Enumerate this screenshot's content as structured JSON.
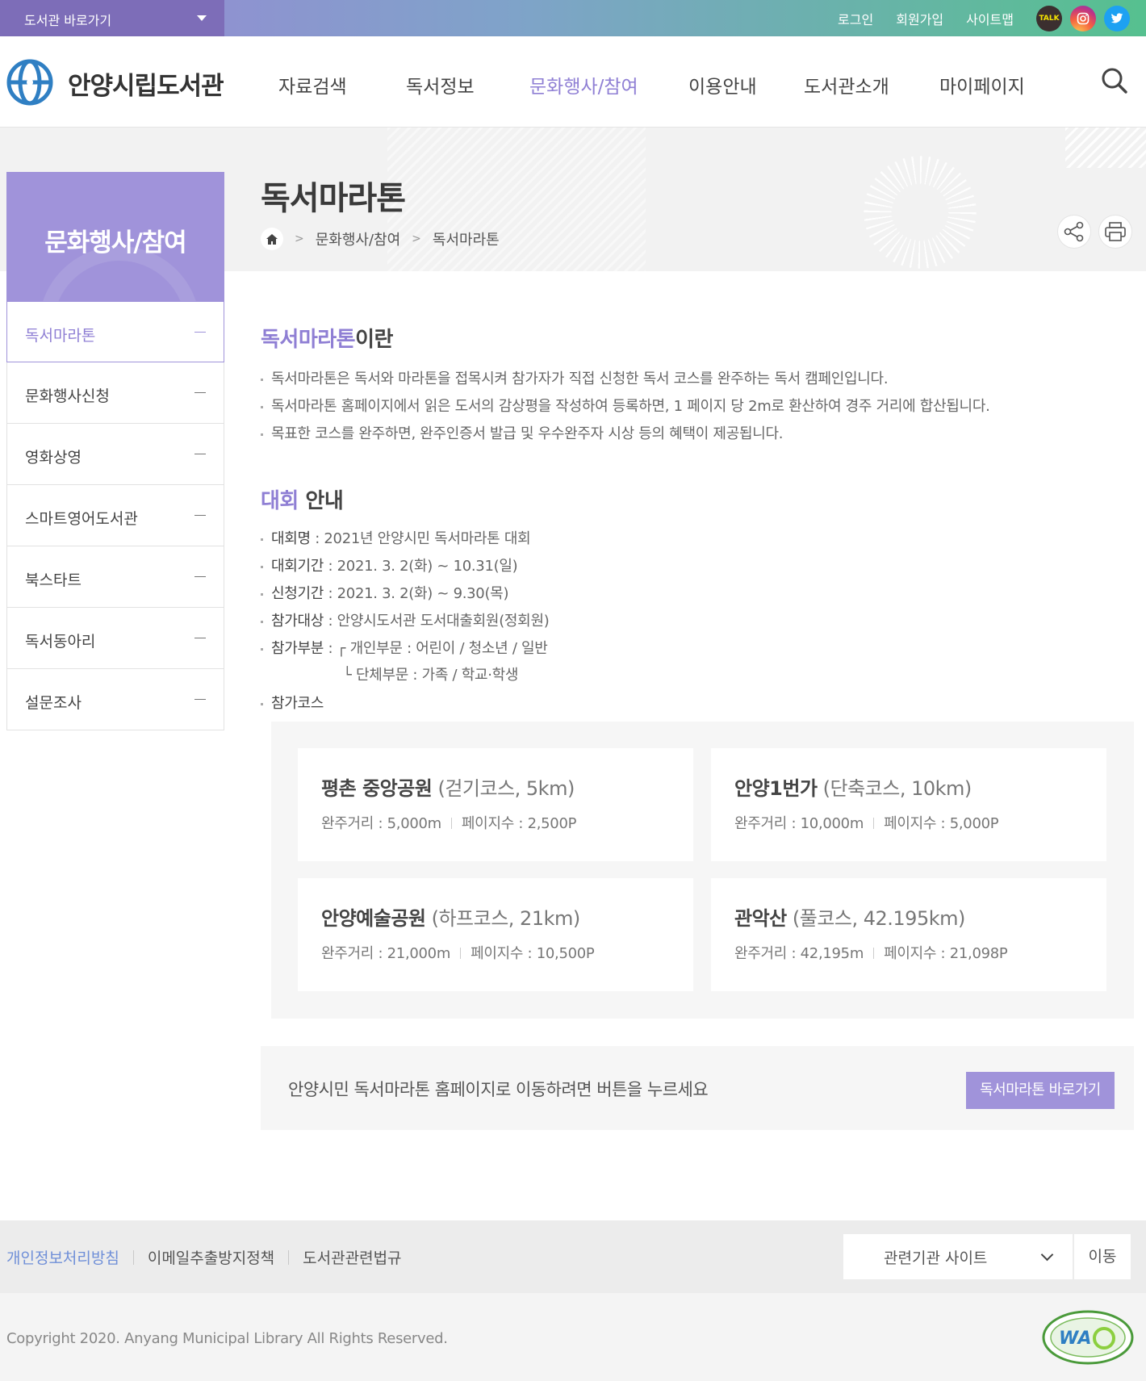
{
  "topbar": {
    "library_select": "도서관 바로가기",
    "links": [
      "로그인",
      "회원가입",
      "사이트맵"
    ],
    "sns": [
      {
        "name": "kakaotalk-icon",
        "label": "TALK"
      },
      {
        "name": "instagram-icon",
        "label": ""
      },
      {
        "name": "twitter-icon",
        "label": ""
      }
    ]
  },
  "header": {
    "logo_text": "안양시립도서관",
    "nav": [
      "자료검색",
      "독서정보",
      "문화행사/참여",
      "이용안내",
      "도서관소개",
      "마이페이지"
    ],
    "active_nav_index": 2
  },
  "sidebar": {
    "title": "문화행사/참여",
    "items": [
      {
        "label": "독서마라톤",
        "active": true
      },
      {
        "label": "문화행사신청",
        "active": false
      },
      {
        "label": "영화상영",
        "active": false
      },
      {
        "label": "스마트영어도서관",
        "active": false
      },
      {
        "label": "북스타트",
        "active": false
      },
      {
        "label": "독서동아리",
        "active": false
      },
      {
        "label": "설문조사",
        "active": false
      }
    ]
  },
  "page": {
    "title": "독서마라톤",
    "breadcrumb": [
      "문화행사/참여",
      "독서마라톤"
    ]
  },
  "section1": {
    "title_highlight": "독서마라톤",
    "title_rest": "이란",
    "items": [
      "독서마라톤은 독서와 마라톤을 접목시켜 참가자가 직접 신청한 독서 코스를 완주하는 독서 캠페인입니다.",
      "독서마라톤 홈페이지에서 읽은 도서의 감상평을 작성하여 등록하면, 1 페이지 당 2m로 환산하여 경주 거리에 합산됩니다.",
      "목표한 코스를 완주하면, 완주인증서 발급 및 우수완주자 시상 등의 혜택이 제공됩니다."
    ]
  },
  "section2": {
    "title_highlight": "대회",
    "title_rest": " 안내",
    "items": [
      {
        "label": "대회명",
        "value": " : 2021년 안양시민 독서마라톤 대회"
      },
      {
        "label": "대회기간",
        "value": " : 2021. 3. 2(화) ~ 10.31(일)"
      },
      {
        "label": "신청기간",
        "value": " : 2021. 3. 2(화) ~  9.30(목)"
      },
      {
        "label": "참가대상",
        "value": " : 안양시도서관 도서대출회원(정회원)"
      },
      {
        "label": "참가부분",
        "value": " :   ┌ 개인부문 : 어린이 / 청소년 / 일반"
      },
      {
        "label": "참가코스",
        "value": ""
      }
    ],
    "sub_line": "└ 단체부문 : 가족 / 학교·학생"
  },
  "courses": [
    {
      "name": "평촌 중앙공원",
      "type": " (걷기코스, 5km)",
      "distance": "완주거리 : 5,000m",
      "pages": "페이지수 : 2,500P"
    },
    {
      "name": "안양1번가",
      "type": " (단축코스, 10km)",
      "distance": "완주거리 : 10,000m",
      "pages": "페이지수 : 5,000P"
    },
    {
      "name": "안양예술공원",
      "type": " (하프코스, 21km)",
      "distance": "완주거리 : 21,000m",
      "pages": "페이지수 : 10,500P"
    },
    {
      "name": "관악산",
      "type": " (풀코스, 42.195km)",
      "distance": "완주거리 : 42,195m",
      "pages": "페이지수 : 21,098P"
    }
  ],
  "gobox": {
    "text": "안양시민 독서마라톤 홈페이지로 이동하려면 버튼을 누르세요",
    "button": "독서마라톤 바로가기"
  },
  "footer": {
    "links": [
      "개인정보처리방침",
      "이메일추출방지정책",
      "도서관관련법규"
    ],
    "related_select": "관련기관 사이트",
    "move_button": "이동",
    "copyright": "Copyright 2020. Anyang Municipal Library All Rights Reserved.",
    "wa_mark": "WA"
  },
  "colors": {
    "accent": "#8f7fd4",
    "sidebar_head": "#a093da",
    "topbar_start": "#9a86d6",
    "topbar_end": "#56c08f"
  }
}
